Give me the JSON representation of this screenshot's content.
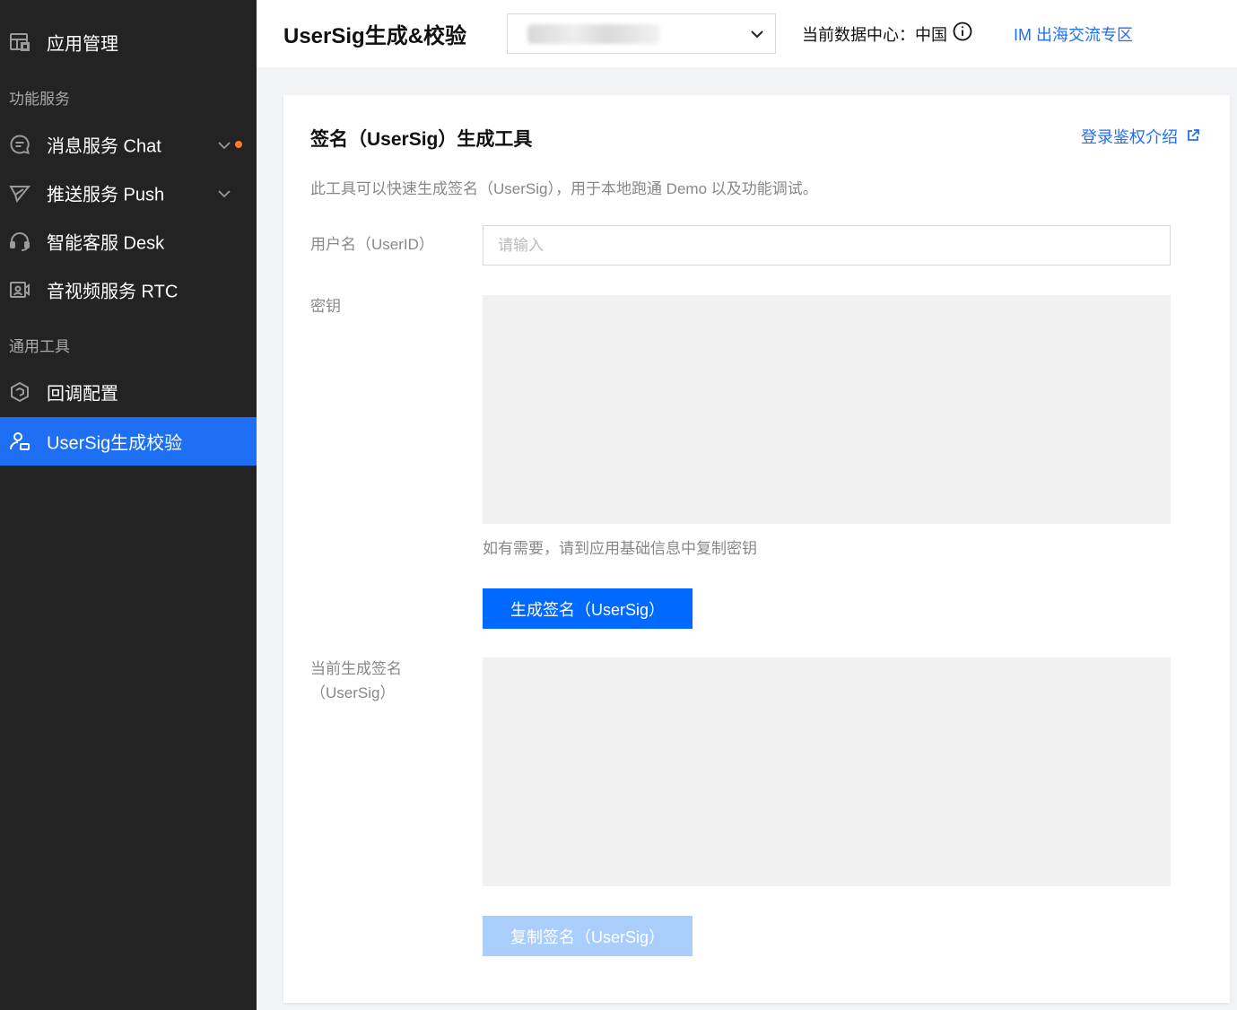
{
  "sidebar": {
    "app_manage": "应用管理",
    "group_services": "功能服务",
    "chat": "消息服务 Chat",
    "push": "推送服务 Push",
    "desk": "智能客服 Desk",
    "rtc": "音视频服务 RTC",
    "group_tools": "通用工具",
    "callback": "回调配置",
    "usersig": "UserSig生成校验"
  },
  "header": {
    "title": "UserSig生成&校验",
    "app_select_value": "",
    "datacenter_label": "当前数据中心：中国",
    "im_link": "IM 出海交流专区"
  },
  "card": {
    "title": "签名（UserSig）生成工具",
    "doc_link": "登录鉴权介绍",
    "description": "此工具可以快速生成签名（UserSig），用于本地跑通 Demo 以及功能调试。",
    "userid_label": "用户名（UserID）",
    "userid_placeholder": "请输入",
    "secret_label": "密钥",
    "secret_hint": "如有需要，请到应用基础信息中复制密钥",
    "generate_button": "生成签名（UserSig）",
    "current_sig_label_1": "当前生成签名",
    "current_sig_label_2": "（UserSig）",
    "copy_button": "复制签名（UserSig）"
  },
  "colors": {
    "sidebar_bg": "#232323",
    "active_bg": "#1f6ff5",
    "link": "#1f6ff5",
    "primary_button": "#0069ff",
    "disabled_button": "#a9cdfd",
    "badge_dot": "#ff7a27"
  }
}
